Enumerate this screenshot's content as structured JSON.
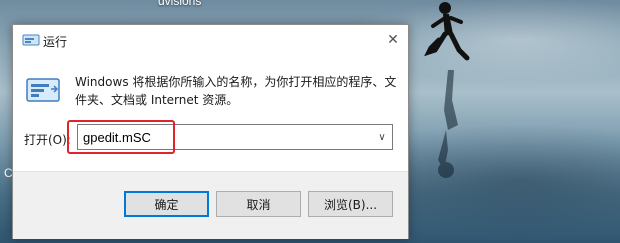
{
  "desktop": {
    "top_label": "dvisions",
    "edge_glyph": "C"
  },
  "dialog": {
    "title": "运行",
    "close_glyph": "✕",
    "description": "Windows 将根据你所输入的名称，为你打开相应的程序、文件夹、文档或 Internet 资源。",
    "open_label": "打开(O):",
    "input_value": "gpedit.mSC",
    "dropdown_glyph": "∨",
    "buttons": {
      "ok": "确定",
      "cancel": "取消",
      "browse": "浏览(B)..."
    },
    "highlight_color": "#e0242b",
    "accent": "#0078d7"
  }
}
